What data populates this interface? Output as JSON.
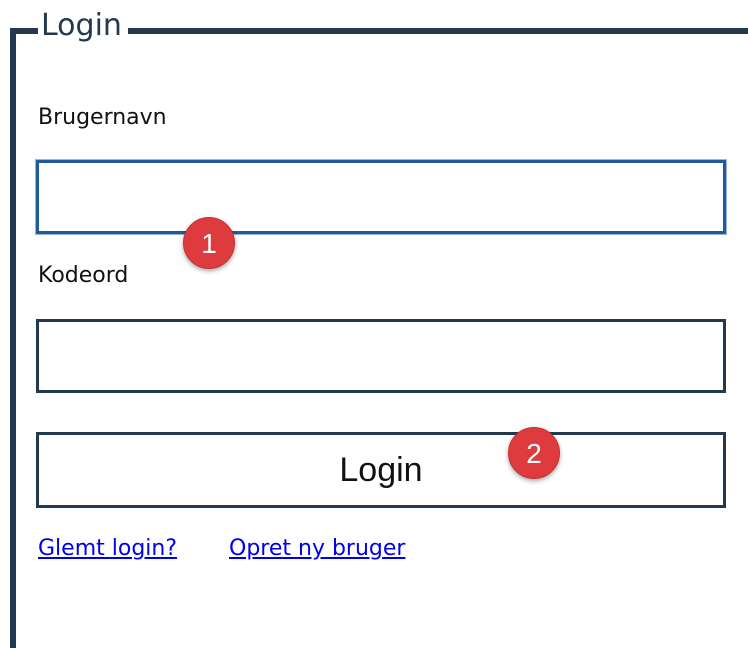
{
  "form": {
    "legend": "Login",
    "username": {
      "label": "Brugernavn",
      "value": "",
      "placeholder": ""
    },
    "password": {
      "label": "Kodeord",
      "value": "",
      "placeholder": ""
    },
    "submit_label": "Login"
  },
  "links": {
    "forgot": "Glemt login?",
    "create": "Opret ny bruger"
  },
  "markers": {
    "one": "1",
    "two": "2"
  },
  "colors": {
    "border": "#22394f",
    "focus_border": "#1f5a9b",
    "link": "#0000ee",
    "marker": "#dd3b3e"
  }
}
